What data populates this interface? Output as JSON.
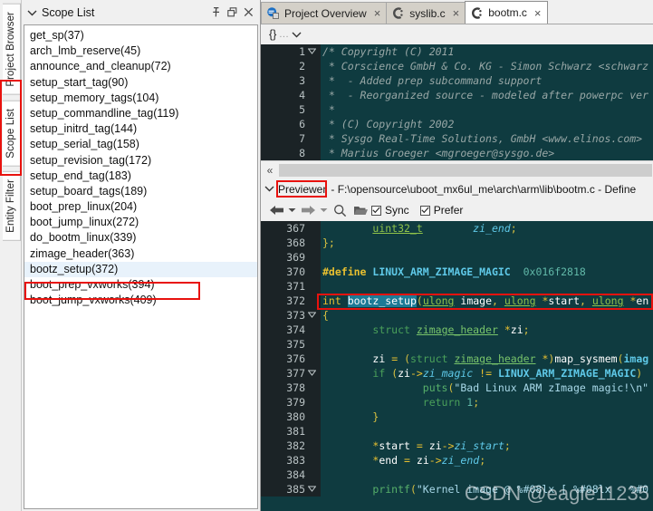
{
  "vertical_tabs": [
    {
      "label": "Project Browser",
      "active": false
    },
    {
      "label": "Scope List",
      "active": true
    },
    {
      "label": "Entity Filter",
      "active": false
    }
  ],
  "scope_panel": {
    "title": "Scope List",
    "collapse_icon": "chevron-down-icon",
    "buttons": [
      {
        "name": "pin-icon",
        "tip": "Pin"
      },
      {
        "name": "restore-icon",
        "tip": "Restore"
      },
      {
        "name": "close-icon",
        "tip": "Close"
      }
    ],
    "items": [
      {
        "label": "get_sp(37)",
        "selected": false
      },
      {
        "label": "arch_lmb_reserve(45)",
        "selected": false
      },
      {
        "label": "announce_and_cleanup(72)",
        "selected": false
      },
      {
        "label": "setup_start_tag(90)",
        "selected": false
      },
      {
        "label": "setup_memory_tags(104)",
        "selected": false
      },
      {
        "label": "setup_commandline_tag(119)",
        "selected": false
      },
      {
        "label": "setup_initrd_tag(144)",
        "selected": false
      },
      {
        "label": "setup_serial_tag(158)",
        "selected": false
      },
      {
        "label": "setup_revision_tag(172)",
        "selected": false
      },
      {
        "label": "setup_end_tag(183)",
        "selected": false
      },
      {
        "label": "setup_board_tags(189)",
        "selected": false
      },
      {
        "label": "boot_prep_linux(204)",
        "selected": false
      },
      {
        "label": "boot_jump_linux(272)",
        "selected": false
      },
      {
        "label": "do_bootm_linux(339)",
        "selected": false
      },
      {
        "label": "zimage_header(363)",
        "selected": false
      },
      {
        "label": "bootz_setup(372)",
        "selected": true
      },
      {
        "label": "boot_prep_vxworks(394)",
        "selected": false
      },
      {
        "label": "boot_jump_vxworks(409)",
        "selected": false
      }
    ]
  },
  "editor_tabs": [
    {
      "label": "Project Overview",
      "icon": "project-overview-icon",
      "active": false,
      "close": "×"
    },
    {
      "label": "syslib.c",
      "icon": "c-file-icon",
      "active": false,
      "close": "×"
    },
    {
      "label": "bootm.c",
      "icon": "c-file-icon",
      "active": true,
      "close": "×"
    }
  ],
  "outline_bar": {
    "braces": "{}",
    "dots": "...",
    "chevron": "chevron-down-icon"
  },
  "top_editor": {
    "lines": [
      {
        "num": "1",
        "fold": true,
        "text": "/* Copyright (C) 2011"
      },
      {
        "num": "2",
        "fold": false,
        "text": " * Corscience GmbH & Co. KG - Simon Schwarz <schwarz"
      },
      {
        "num": "3",
        "fold": false,
        "text": " *  - Added prep subcommand support"
      },
      {
        "num": "4",
        "fold": false,
        "text": " *  - Reorganized source - modeled after powerpc ver"
      },
      {
        "num": "5",
        "fold": false,
        "text": " *"
      },
      {
        "num": "6",
        "fold": false,
        "text": " * (C) Copyright 2002"
      },
      {
        "num": "7",
        "fold": false,
        "text": " * Sysgo Real-Time Solutions, GmbH <www.elinos.com>"
      },
      {
        "num": "8",
        "fold": false,
        "text": " * Marius Groeger <mgroeger@sysgo.de>"
      }
    ]
  },
  "splitter": {
    "arrow": "«"
  },
  "previewer": {
    "chevron": "chevron-down-icon",
    "label": "Previewer",
    "path": "- F:\\opensource\\uboot_mx6ul_me\\arch\\arm\\lib\\bootm.c - Define",
    "toolbar": {
      "back": "back-arrow-icon",
      "back_menu": "dropdown-arrow-icon",
      "forward": "forward-arrow-icon",
      "forward_menu": "dropdown-arrow-icon",
      "search": "search-icon",
      "folder": "open-folder-icon",
      "sync_label": "Sync",
      "sync_checked": true,
      "prefer_label": "Prefer",
      "prefer_checked": true
    }
  },
  "preview_code": {
    "lines": [
      {
        "num": "367",
        "fold": false
      },
      {
        "num": "368",
        "fold": false
      },
      {
        "num": "369",
        "fold": false
      },
      {
        "num": "370",
        "fold": false
      },
      {
        "num": "371",
        "fold": false
      },
      {
        "num": "372",
        "fold": false
      },
      {
        "num": "373",
        "fold": true
      },
      {
        "num": "374",
        "fold": false
      },
      {
        "num": "375",
        "fold": false
      },
      {
        "num": "376",
        "fold": false
      },
      {
        "num": "377",
        "fold": true
      },
      {
        "num": "378",
        "fold": false
      },
      {
        "num": "379",
        "fold": false
      },
      {
        "num": "380",
        "fold": false
      },
      {
        "num": "381",
        "fold": false
      },
      {
        "num": "382",
        "fold": false
      },
      {
        "num": "383",
        "fold": false
      },
      {
        "num": "384",
        "fold": false
      },
      {
        "num": "385",
        "fold": true
      }
    ],
    "text_lines": [
      "        uint32_t        zi_end;",
      "};",
      "",
      "#define LINUX_ARM_ZIMAGE_MAGIC  0x016f2818",
      "",
      "int bootz_setup(ulong image, ulong *start, ulong *en",
      "{",
      "        struct zimage_header *zi;",
      "",
      "        zi = (struct zimage_header *)map_sysmem(imag",
      "        if (zi->zi_magic != LINUX_ARM_ZIMAGE_MAGIC)",
      "                puts(\"Bad Linux ARM zImage magic!\\n\"",
      "                return 1;",
      "        }",
      "",
      "        *start = zi->zi_start;",
      "        *end = zi->zi_end;",
      "",
      "        printf(\"Kernel image @ %#08lx [ %#08lx - %#0"
    ],
    "highlighted_symbol": "bootz_setup",
    "highlight_color": "#e8120e"
  },
  "watermark": "CSDN @eagle11235"
}
